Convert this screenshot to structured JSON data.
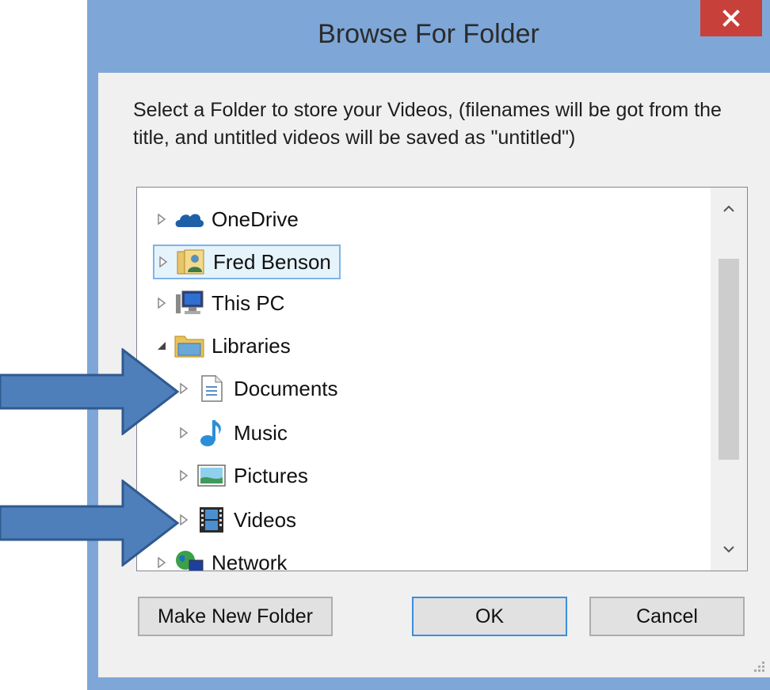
{
  "dialog": {
    "title": "Browse For Folder",
    "close_label": "×",
    "instructions": "Select a Folder to store your Videos, (filenames will be got from the title, and untitled videos will be saved as \"untitled\")"
  },
  "tree": {
    "items": [
      {
        "label": "OneDrive",
        "icon": "onedrive-cloud-icon",
        "expander": "collapsed"
      },
      {
        "label": "Fred Benson",
        "icon": "user-folder-icon",
        "expander": "collapsed",
        "selected": true
      },
      {
        "label": "This PC",
        "icon": "computer-icon",
        "expander": "collapsed"
      },
      {
        "label": "Libraries",
        "icon": "libraries-folder-icon",
        "expander": "expanded"
      },
      {
        "label": "Documents",
        "icon": "documents-icon",
        "expander": "collapsed"
      },
      {
        "label": "Music",
        "icon": "music-note-icon",
        "expander": "collapsed"
      },
      {
        "label": "Pictures",
        "icon": "pictures-icon",
        "expander": "collapsed"
      },
      {
        "label": "Videos",
        "icon": "videos-filmstrip-icon",
        "expander": "collapsed"
      },
      {
        "label": "Network",
        "icon": "network-icon",
        "expander": "collapsed"
      }
    ]
  },
  "buttons": {
    "make_new_folder": "Make New Folder",
    "ok": "OK",
    "cancel": "Cancel"
  },
  "annotations": {
    "arrow_color": "#4f7fbb",
    "arrow_border": "#2f5a8f",
    "arrows": [
      "pointing-to-documents",
      "pointing-to-videos"
    ]
  },
  "colors": {
    "frame": "#7ea7d8",
    "close_button": "#c7403a",
    "selection_fill": "#e5f3fb",
    "selection_border": "#7eb4ea"
  }
}
